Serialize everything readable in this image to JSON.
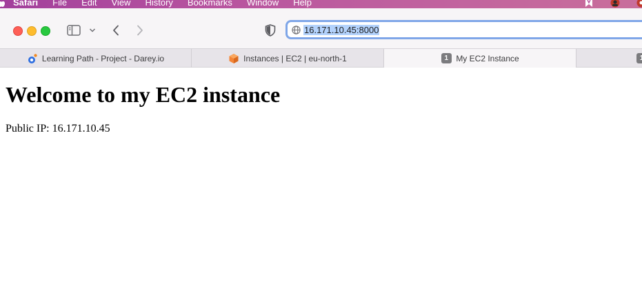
{
  "menubar": {
    "items": [
      "Safari",
      "File",
      "Edit",
      "View",
      "History",
      "Bookmarks",
      "Window",
      "Help"
    ]
  },
  "address_bar": {
    "url": "16.171.10.45:8000"
  },
  "tabs": [
    {
      "label": "Learning Path - Project - Darey.io",
      "icon": "darey-favicon-icon",
      "active": false
    },
    {
      "label": "Instances | EC2 | eu-north-1",
      "icon": "aws-ec2-favicon-icon",
      "active": false
    },
    {
      "label": "My EC2 Instance",
      "icon": "number-badge-icon",
      "badge": "1",
      "active": true
    },
    {
      "label": "",
      "icon": "number-badge-icon",
      "badge": "1",
      "active": false
    }
  ],
  "page": {
    "heading": "Welcome to my EC2 instance",
    "text": "Public IP: 16.171.10.45"
  },
  "colors": {
    "menubar_accent": "#b8549f",
    "address_focus": "#7fa6e8",
    "url_selection": "#b3d2fc"
  }
}
